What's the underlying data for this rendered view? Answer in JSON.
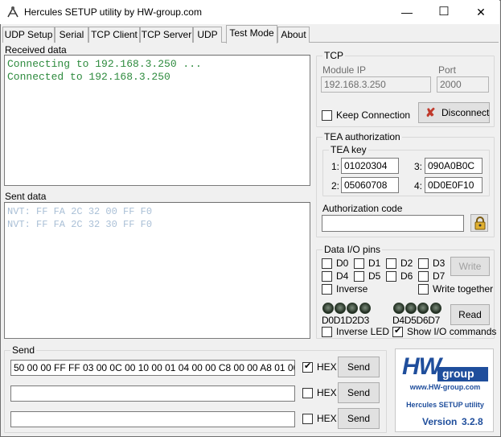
{
  "window": {
    "title": "Hercules SETUP utility by HW-group.com",
    "minimize": "—",
    "maximize": "☐",
    "close": "✕"
  },
  "tabs": [
    {
      "label": "UDP Setup"
    },
    {
      "label": "Serial"
    },
    {
      "label": "TCP Client"
    },
    {
      "label": "TCP Server"
    },
    {
      "label": "UDP"
    },
    {
      "label": "Test Mode"
    },
    {
      "label": "About"
    }
  ],
  "received": {
    "label": "Received data",
    "lines": [
      "Connecting to 192.168.3.250 ...",
      "Connected to 192.168.3.250"
    ]
  },
  "sent": {
    "label": "Sent data",
    "lines": [
      "NVT: FF FA 2C 32 00 FF F0",
      "NVT: FF FA 2C 32 30 FF F0"
    ]
  },
  "tcp": {
    "title": "TCP",
    "module_ip_label": "Module IP",
    "module_ip": "192.168.3.250",
    "port_label": "Port",
    "port": "2000",
    "keep_connection": "Keep Connection",
    "disconnect": "Disconnect"
  },
  "tea": {
    "title": "TEA authorization",
    "key_title": "TEA key",
    "k1_label": "1:",
    "k1": "01020304",
    "k2_label": "2:",
    "k2": "05060708",
    "k3_label": "3:",
    "k3": "090A0B0C",
    "k4_label": "4:",
    "k4": "0D0E0F10",
    "auth_label": "Authorization code",
    "auth_value": ""
  },
  "dio": {
    "title": "Data I/O pins",
    "pins": [
      "D0",
      "D1",
      "D2",
      "D3",
      "D4",
      "D5",
      "D6",
      "D7"
    ],
    "write": "Write",
    "inverse": "Inverse",
    "write_together": "Write together",
    "led_labels_left": "D0D1D2D3",
    "led_labels_right": "D4D5D6D7",
    "read": "Read",
    "inverse_led": "Inverse LED",
    "show_io": "Show I/O commands"
  },
  "send": {
    "title": "Send",
    "rows": [
      {
        "value": "50 00 00 FF FF 03 00 0C 00 10 00 01 04 00 00 C8 00 00 A8 01 00",
        "hex": "HEX",
        "hex_checked": true,
        "button": "Send"
      },
      {
        "value": "",
        "hex": "HEX",
        "hex_checked": false,
        "button": "Send"
      },
      {
        "value": "",
        "hex": "HEX",
        "hex_checked": false,
        "button": "Send"
      }
    ]
  },
  "logo": {
    "hw": "HW",
    "group": "group",
    "url": "www.HW-group.com",
    "product": "Hercules SETUP utility",
    "version_label": "Version",
    "version": "3.2.8"
  },
  "colors": {
    "received_text": "#2e8b3e",
    "sent_text": "#a9bfd6",
    "logo_blue": "#1f4e9c",
    "disconnect_x": "#c0392b"
  }
}
